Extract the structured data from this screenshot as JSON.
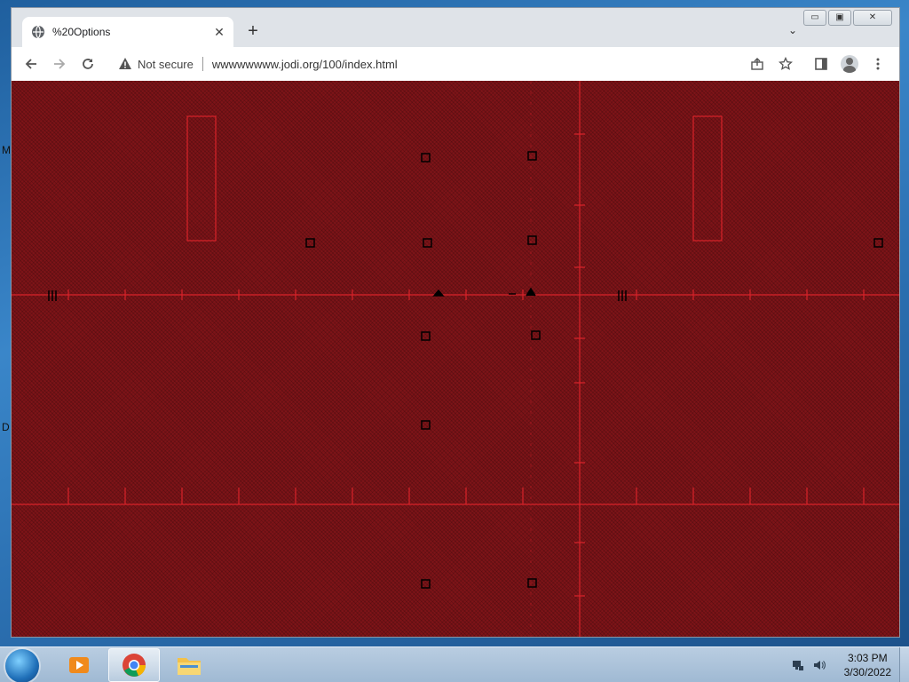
{
  "desktop": {
    "edge_labels": [
      "M",
      "D"
    ]
  },
  "browser": {
    "tab": {
      "title": "%20Options",
      "favicon": "globe-icon",
      "close_glyph": "✕"
    },
    "new_tab_glyph": "+",
    "tab_search_glyph": "⌄",
    "window_controls": {
      "minimize": "▭",
      "maximize": "▣",
      "close": "✕"
    },
    "toolbar": {
      "back": "back-arrow-icon",
      "forward": "forward-arrow-icon",
      "reload": "reload-icon",
      "security_icon": "warning-triangle-icon",
      "security_text": "Not secure",
      "url": "wwwwwwww.jodi.org/100/index.html",
      "share": "share-icon",
      "bookmark": "star-icon",
      "side_panel": "side-panel-icon",
      "profile": "profile-icon",
      "menu": "kebab-menu-icon"
    }
  },
  "page": {
    "background": "#7e1418",
    "line_color": "#d8232a",
    "mark_color": "#000000"
  },
  "taskbar": {
    "apps": [
      {
        "name": "media-player-icon",
        "active": false
      },
      {
        "name": "chrome-icon",
        "active": true
      },
      {
        "name": "file-explorer-icon",
        "active": false
      }
    ],
    "clock": {
      "time": "3:03 PM",
      "date": "3/30/2022"
    }
  }
}
